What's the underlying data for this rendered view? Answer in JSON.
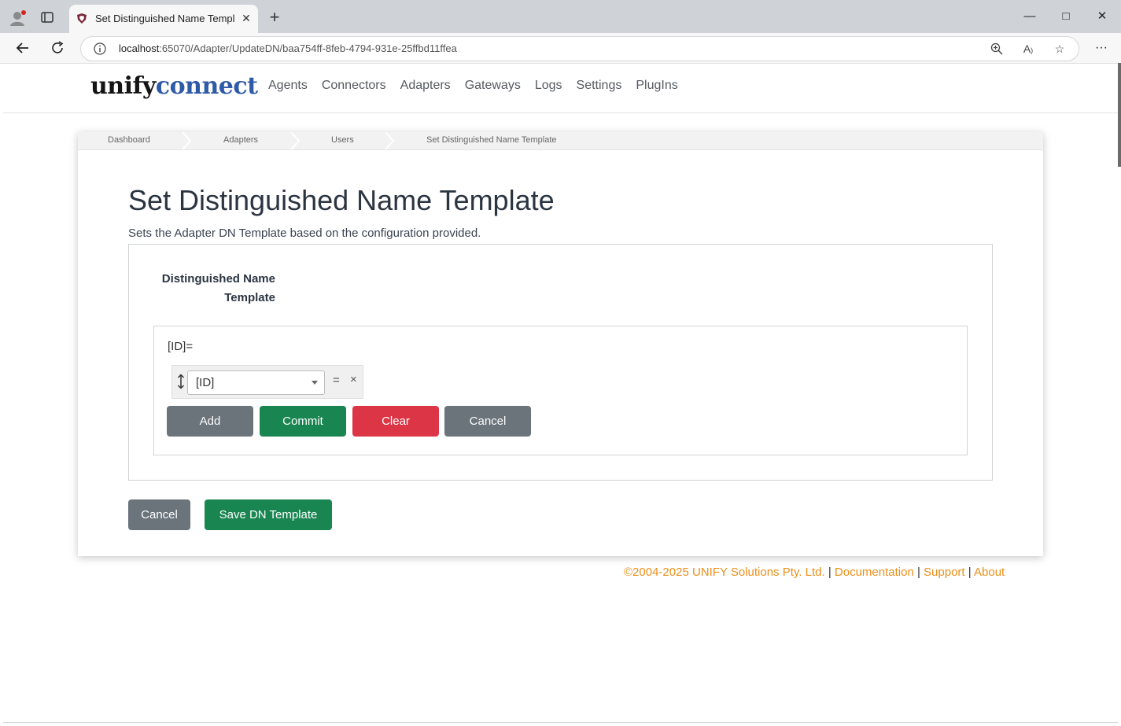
{
  "browser": {
    "tab_title": "Set Distinguished Name Template",
    "tab_close": "✕",
    "new_tab": "+",
    "url_host": "localhost",
    "url_rest": ":65070/Adapter/UpdateDN/baa754ff-8feb-4794-931e-25ffbd11ffea",
    "window_controls": [
      "minimize-icon",
      "maximize-icon",
      "close-icon"
    ]
  },
  "brand": {
    "part1": "unify",
    "part2": "connect"
  },
  "nav": [
    "Agents",
    "Connectors",
    "Adapters",
    "Gateways",
    "Logs",
    "Settings",
    "PlugIns"
  ],
  "breadcrumbs": [
    "Dashboard",
    "Adapters",
    "Users",
    "Set Distinguished Name Template"
  ],
  "page": {
    "title": "Set Distinguished Name Template",
    "description": "Sets the Adapter DN Template based on the configuration provided.",
    "field_label_line1": "Distinguished Name",
    "field_label_line2": "Template",
    "template_preview": "[ID]=",
    "rule": {
      "attribute": "[ID]",
      "operator": "=",
      "remove": "×"
    },
    "buttons": {
      "add": "Add",
      "commit": "Commit",
      "clear": "Clear",
      "cancel_inner": "Cancel"
    },
    "cancel": "Cancel",
    "save": "Save DN Template"
  },
  "footer": {
    "copyright": "©2004-2025 UNIFY Solutions Pty. Ltd.",
    "separator": "|",
    "documentation": "Documentation",
    "support": "Support",
    "about": "About"
  },
  "colors": {
    "brand_blue": "#2f5aa8",
    "primary_green": "#198551",
    "danger_red": "#dc3545",
    "secondary_gray": "#6b737b",
    "footer_orange": "#ea8f1a"
  }
}
